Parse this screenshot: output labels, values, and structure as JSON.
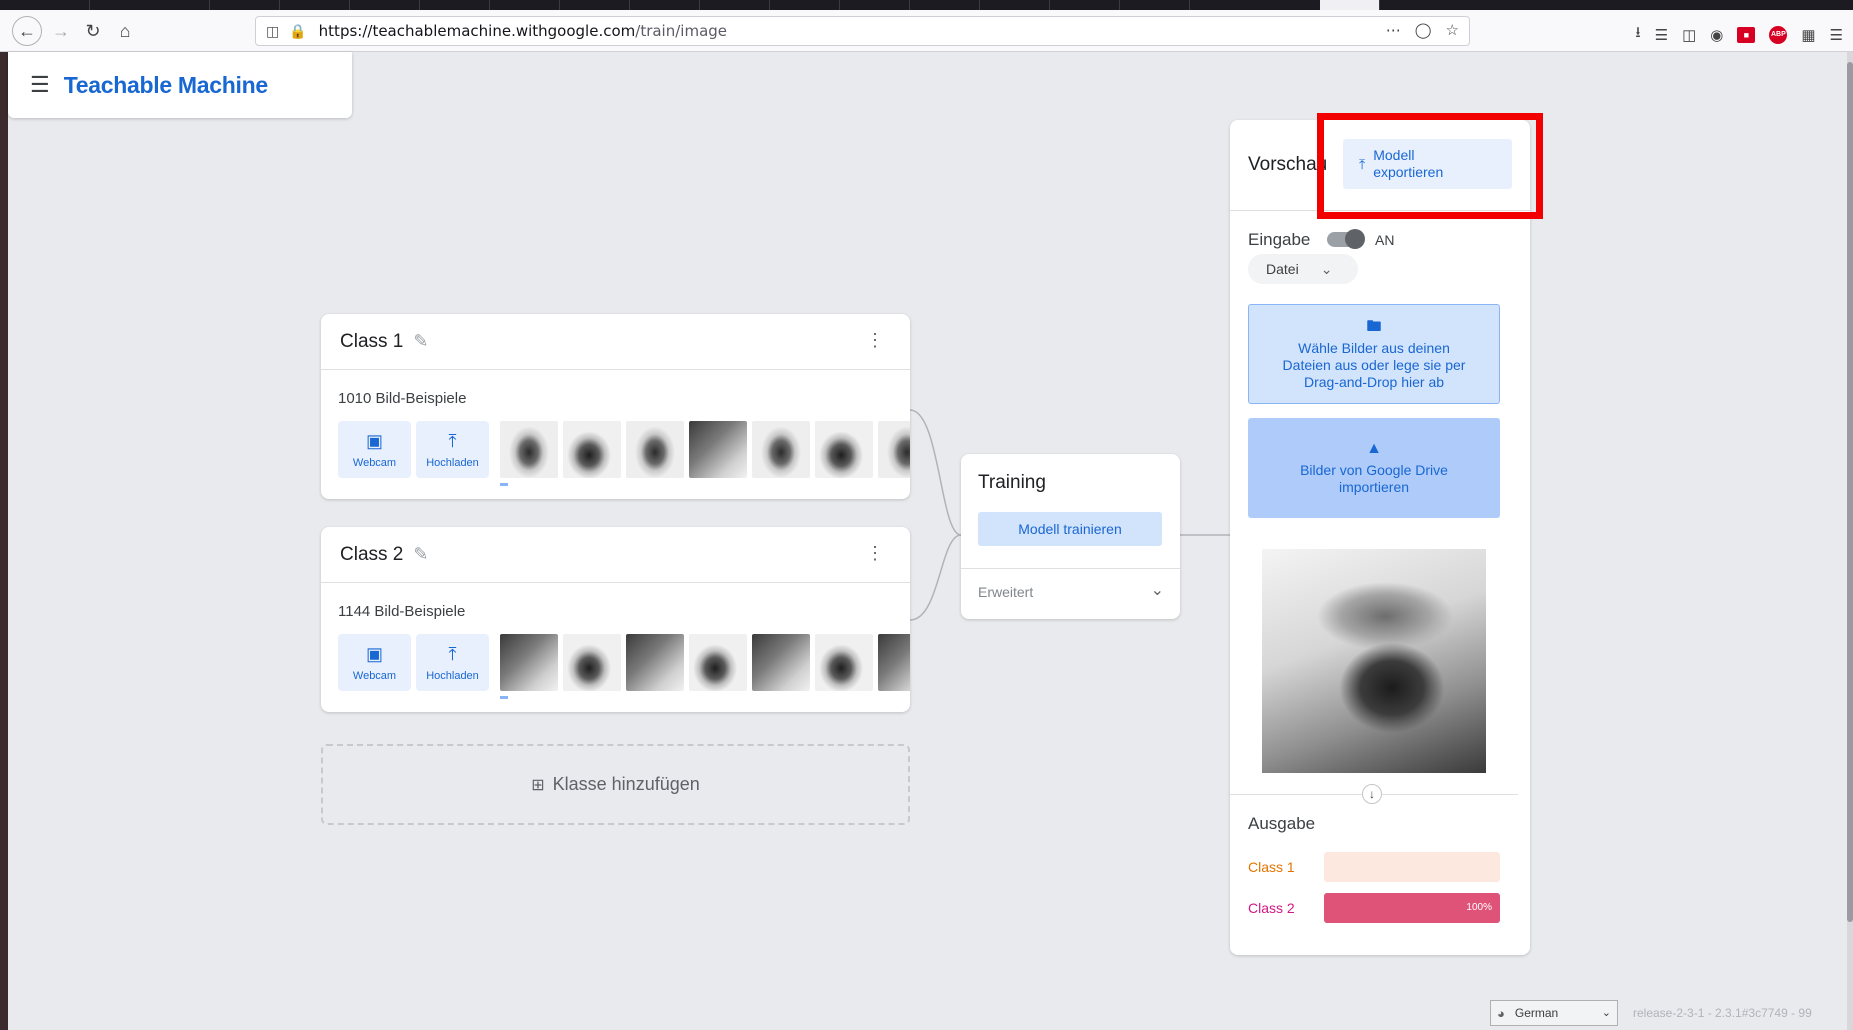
{
  "browser": {
    "url_host": "https://teachablemachine.withgoogle.com",
    "url_path": "/train/image"
  },
  "app": {
    "title": "Teachable Machine"
  },
  "classes": [
    {
      "name": "Class 1",
      "count": "1010 Bild-Beispiele",
      "webcam": "Webcam",
      "upload": "Hochladen"
    },
    {
      "name": "Class 2",
      "count": "1144 Bild-Beispiele",
      "webcam": "Webcam",
      "upload": "Hochladen"
    }
  ],
  "add_class": "Klasse hinzufügen",
  "training": {
    "title": "Training",
    "train_button": "Modell trainieren",
    "advanced": "Erweitert"
  },
  "preview": {
    "title": "Vorschau",
    "export_button": "Modell exportieren",
    "input_label": "Eingabe",
    "toggle_state": "AN",
    "source_select": "Datei",
    "drop_text": "Wähle Bilder aus deinen Dateien aus oder lege sie per Drag-and-Drop hier ab",
    "drive_text": "Bilder von Google Drive importieren",
    "output_label": "Ausgabe",
    "outputs": [
      {
        "name": "Class 1",
        "color": "#e37400",
        "bar_bg": "#fde8df",
        "fill_color": "#e37400",
        "value": 0,
        "label": ""
      },
      {
        "name": "Class 2",
        "color": "#d01884",
        "bar_bg": "#fde8df",
        "fill_color": "#e05379",
        "value": 100,
        "label": "100%"
      }
    ]
  },
  "footer": {
    "language": "German",
    "release": "release-2-3-1 - 2.3.1#3c7749 - 99"
  },
  "colors": {
    "accent": "#1967d2",
    "highlight_box": "#f20000"
  }
}
